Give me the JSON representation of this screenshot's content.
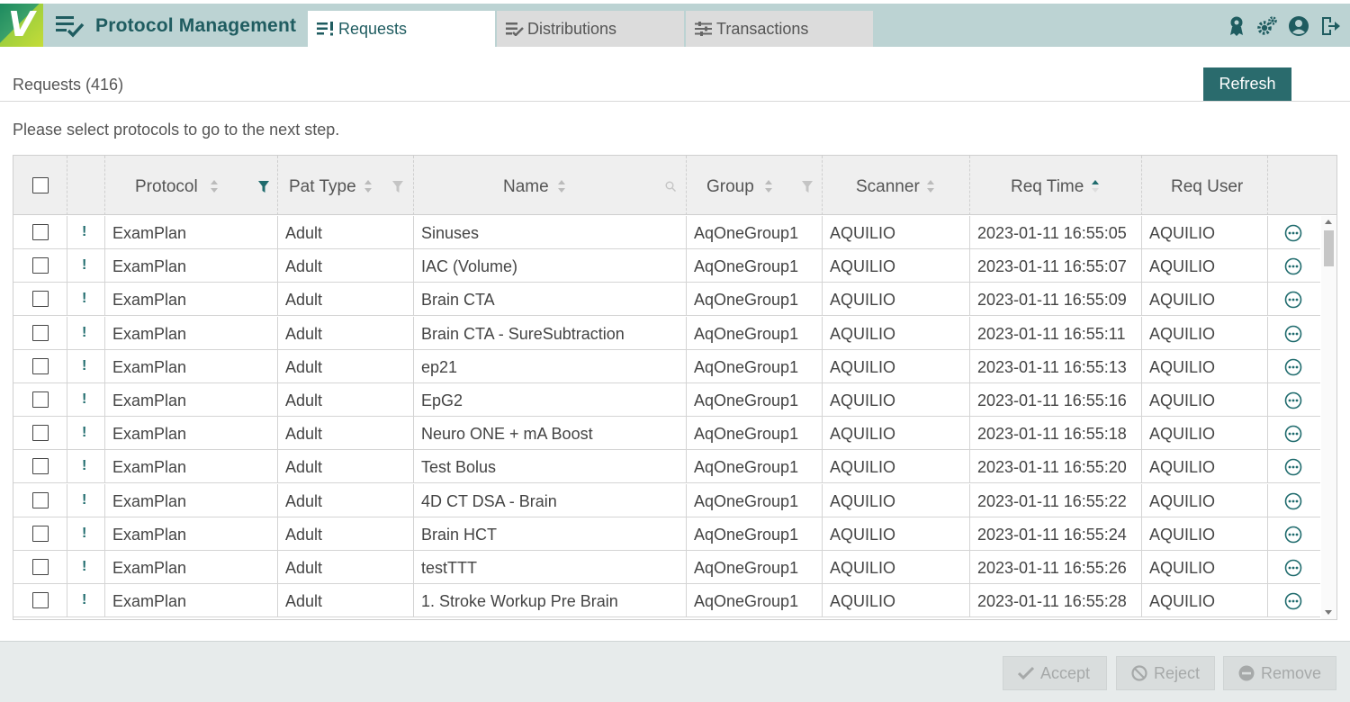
{
  "app": {
    "logo_letter": "V",
    "title": "Protocol Management"
  },
  "tabs": [
    {
      "label": "Requests",
      "icon": "requests-icon",
      "active": true
    },
    {
      "label": "Distributions",
      "icon": "distributions-icon",
      "active": false
    },
    {
      "label": "Transactions",
      "icon": "transactions-icon",
      "active": false
    }
  ],
  "header_icons": [
    "award-icon",
    "gears-icon",
    "user-icon",
    "logout-icon"
  ],
  "page": {
    "title": "Requests (416)",
    "refresh_label": "Refresh",
    "instruction": "Please select protocols to go to the next step."
  },
  "table": {
    "columns": {
      "protocol": "Protocol",
      "pat_type": "Pat Type",
      "name": "Name",
      "group": "Group",
      "scanner": "Scanner",
      "req_time": "Req Time",
      "req_user": "Req User"
    },
    "rows": [
      {
        "protocol": "ExamPlan",
        "pat_type": "Adult",
        "name": "Sinuses",
        "group": "AqOneGroup1",
        "scanner": "AQUILIO",
        "req_time": "2023-01-11 16:55:05",
        "req_user": "AQUILIO"
      },
      {
        "protocol": "ExamPlan",
        "pat_type": "Adult",
        "name": "IAC (Volume)",
        "group": "AqOneGroup1",
        "scanner": "AQUILIO",
        "req_time": "2023-01-11 16:55:07",
        "req_user": "AQUILIO"
      },
      {
        "protocol": "ExamPlan",
        "pat_type": "Adult",
        "name": "Brain CTA",
        "group": "AqOneGroup1",
        "scanner": "AQUILIO",
        "req_time": "2023-01-11 16:55:09",
        "req_user": "AQUILIO"
      },
      {
        "protocol": "ExamPlan",
        "pat_type": "Adult",
        "name": "Brain CTA - SureSubtraction",
        "group": "AqOneGroup1",
        "scanner": "AQUILIO",
        "req_time": "2023-01-11 16:55:11",
        "req_user": "AQUILIO"
      },
      {
        "protocol": "ExamPlan",
        "pat_type": "Adult",
        "name": "ep21",
        "group": "AqOneGroup1",
        "scanner": "AQUILIO",
        "req_time": "2023-01-11 16:55:13",
        "req_user": "AQUILIO"
      },
      {
        "protocol": "ExamPlan",
        "pat_type": "Adult",
        "name": "EpG2",
        "group": "AqOneGroup1",
        "scanner": "AQUILIO",
        "req_time": "2023-01-11 16:55:16",
        "req_user": "AQUILIO"
      },
      {
        "protocol": "ExamPlan",
        "pat_type": "Adult",
        "name": "Neuro ONE + mA Boost",
        "group": "AqOneGroup1",
        "scanner": "AQUILIO",
        "req_time": "2023-01-11 16:55:18",
        "req_user": "AQUILIO"
      },
      {
        "protocol": "ExamPlan",
        "pat_type": "Adult",
        "name": "Test Bolus",
        "group": "AqOneGroup1",
        "scanner": "AQUILIO",
        "req_time": "2023-01-11 16:55:20",
        "req_user": "AQUILIO"
      },
      {
        "protocol": "ExamPlan",
        "pat_type": "Adult",
        "name": "4D CT DSA - Brain",
        "group": "AqOneGroup1",
        "scanner": "AQUILIO",
        "req_time": "2023-01-11 16:55:22",
        "req_user": "AQUILIO"
      },
      {
        "protocol": "ExamPlan",
        "pat_type": "Adult",
        "name": "Brain HCT",
        "group": "AqOneGroup1",
        "scanner": "AQUILIO",
        "req_time": "2023-01-11 16:55:24",
        "req_user": "AQUILIO"
      },
      {
        "protocol": "ExamPlan",
        "pat_type": "Adult",
        "name": "testTTT",
        "group": "AqOneGroup1",
        "scanner": "AQUILIO",
        "req_time": "2023-01-11 16:55:26",
        "req_user": "AQUILIO"
      },
      {
        "protocol": "ExamPlan",
        "pat_type": "Adult",
        "name": "1. Stroke Workup Pre Brain",
        "group": "AqOneGroup1",
        "scanner": "AQUILIO",
        "req_time": "2023-01-11 16:55:28",
        "req_user": "AQUILIO"
      }
    ]
  },
  "footer": {
    "accept_label": "Accept",
    "reject_label": "Reject",
    "remove_label": "Remove"
  },
  "colors": {
    "accent": "#2a6b6d",
    "header_bg": "#bcd3d3",
    "title_text": "#1f5c60"
  }
}
